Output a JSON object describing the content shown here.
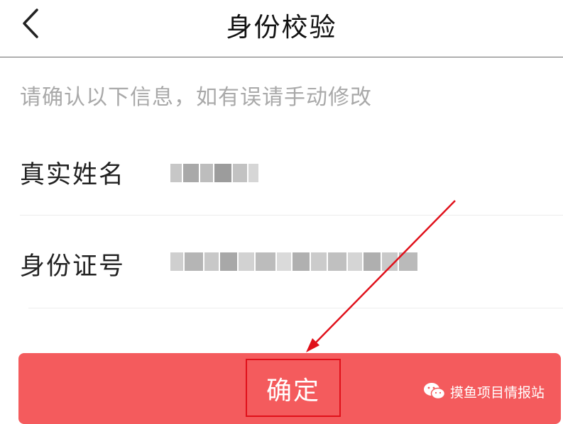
{
  "header": {
    "title": "身份校验",
    "back_icon": "chevron-left-icon"
  },
  "form": {
    "hint": "请确认以下信息，如有误请手动修改",
    "name_label": "真实姓名",
    "id_label": "身份证号"
  },
  "confirm": {
    "label": "确定"
  },
  "watermark": {
    "text": "摸鱼项目情报站",
    "icon": "wechat-icon"
  },
  "colors": {
    "accent_button": "#f45b5d",
    "annotation_red": "#e0101a",
    "hint_text": "#a9a9a9"
  }
}
